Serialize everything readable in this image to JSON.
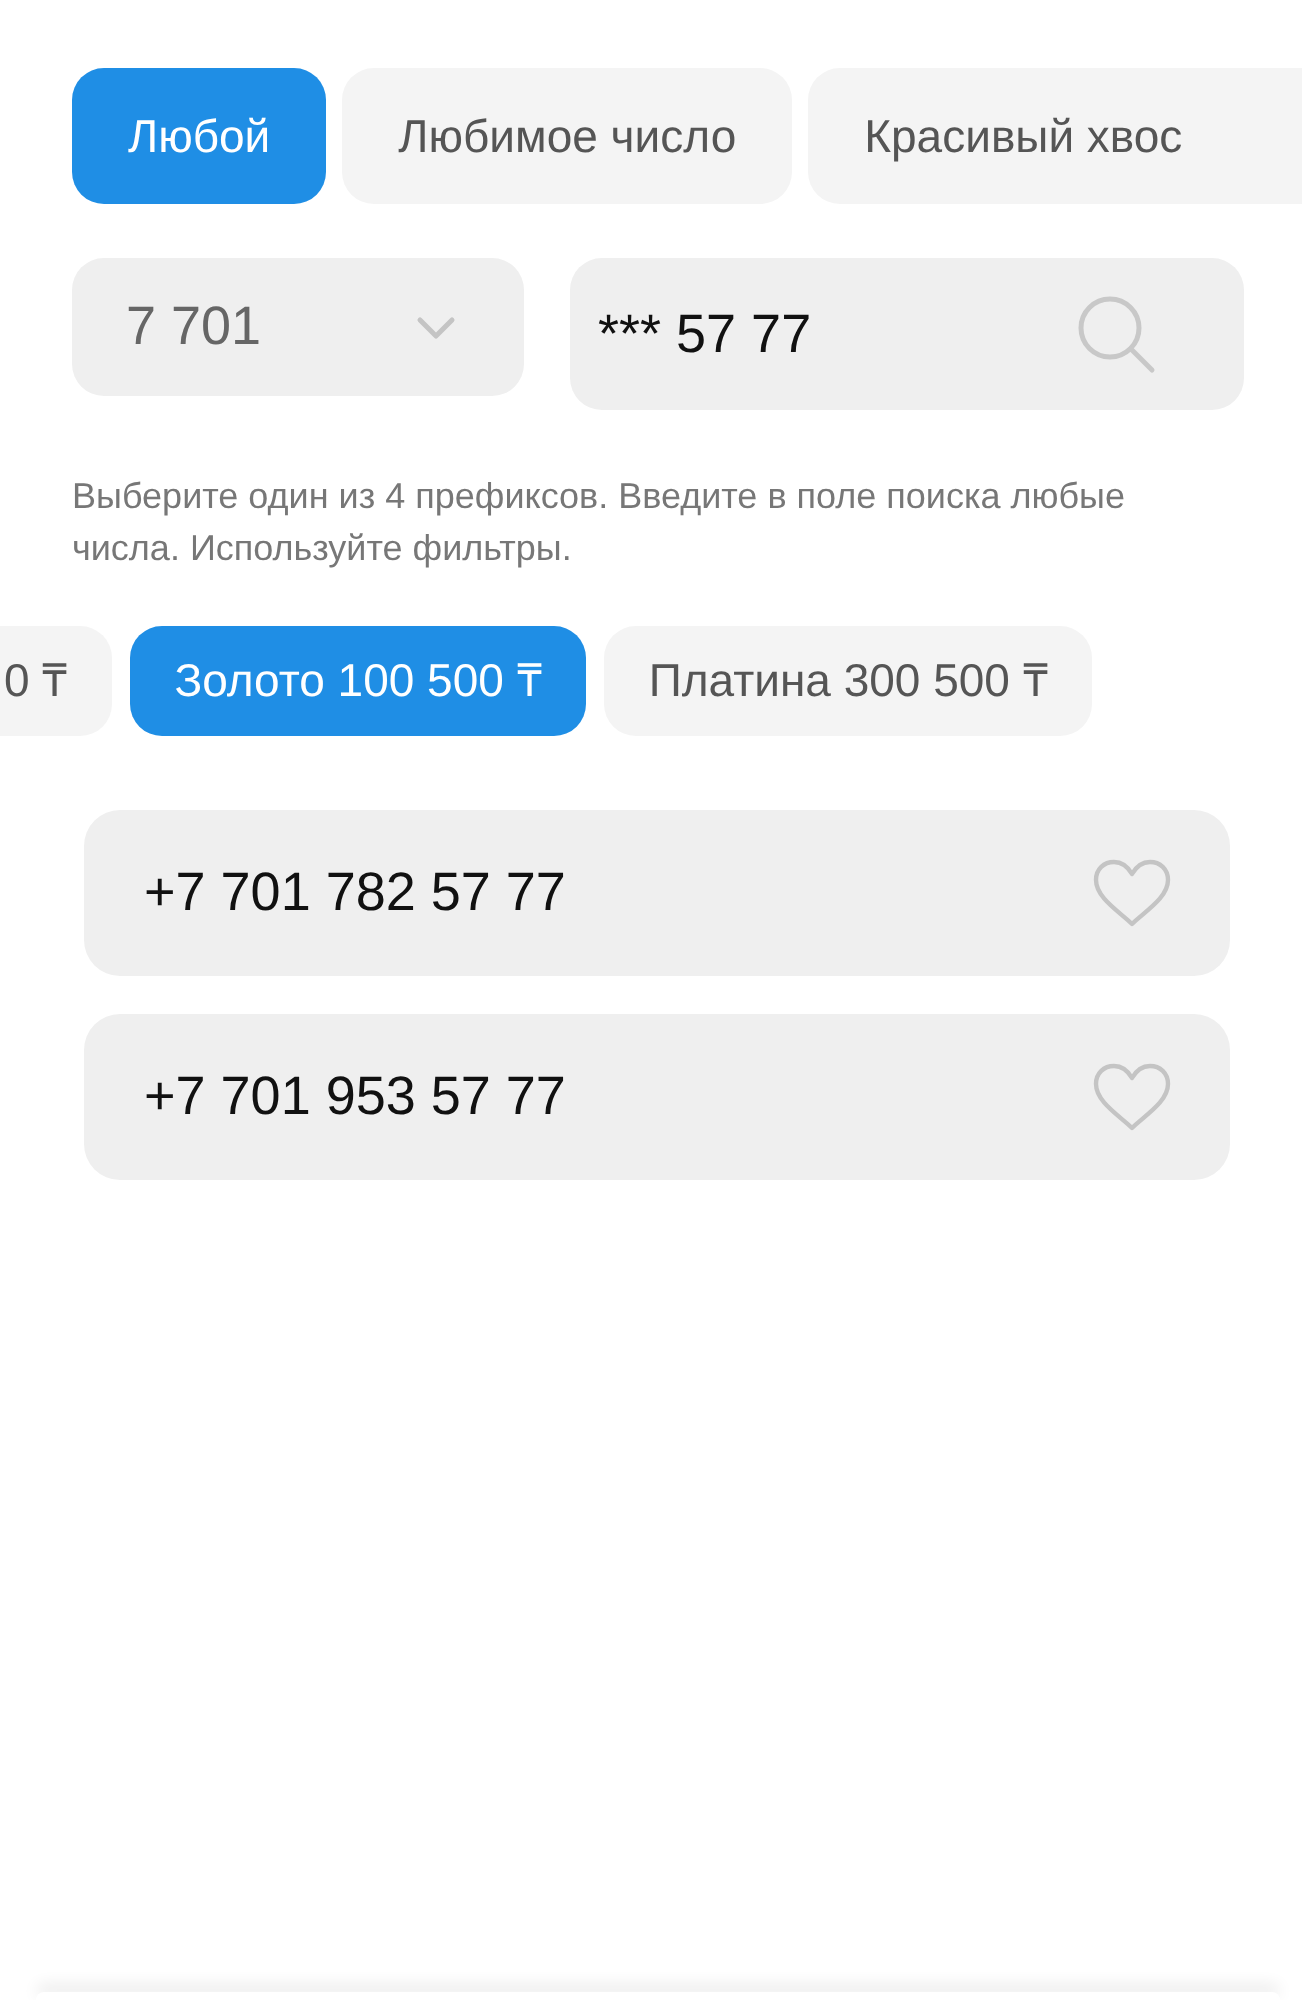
{
  "filter_tabs": [
    {
      "label": "Любой",
      "selected": true
    },
    {
      "label": "Любимое число",
      "selected": false
    },
    {
      "label": "Красивый хвос",
      "selected": false
    }
  ],
  "prefix_select": {
    "value": "7 701"
  },
  "search": {
    "value": "*** 57 77"
  },
  "hint": "Выберите один из 4 префиксов. Введите в поле поиска любые числа. Используйте фильтры.",
  "price_filters": [
    {
      "label": "0 ₸",
      "selected": false
    },
    {
      "label": "Золото 100 500 ₸",
      "selected": true
    },
    {
      "label": "Платина 300 500 ₸",
      "selected": false
    }
  ],
  "numbers": [
    {
      "number": "+7 701 782 57 77",
      "favorite": false
    },
    {
      "number": "+7 701 953 57 77",
      "favorite": false
    }
  ]
}
